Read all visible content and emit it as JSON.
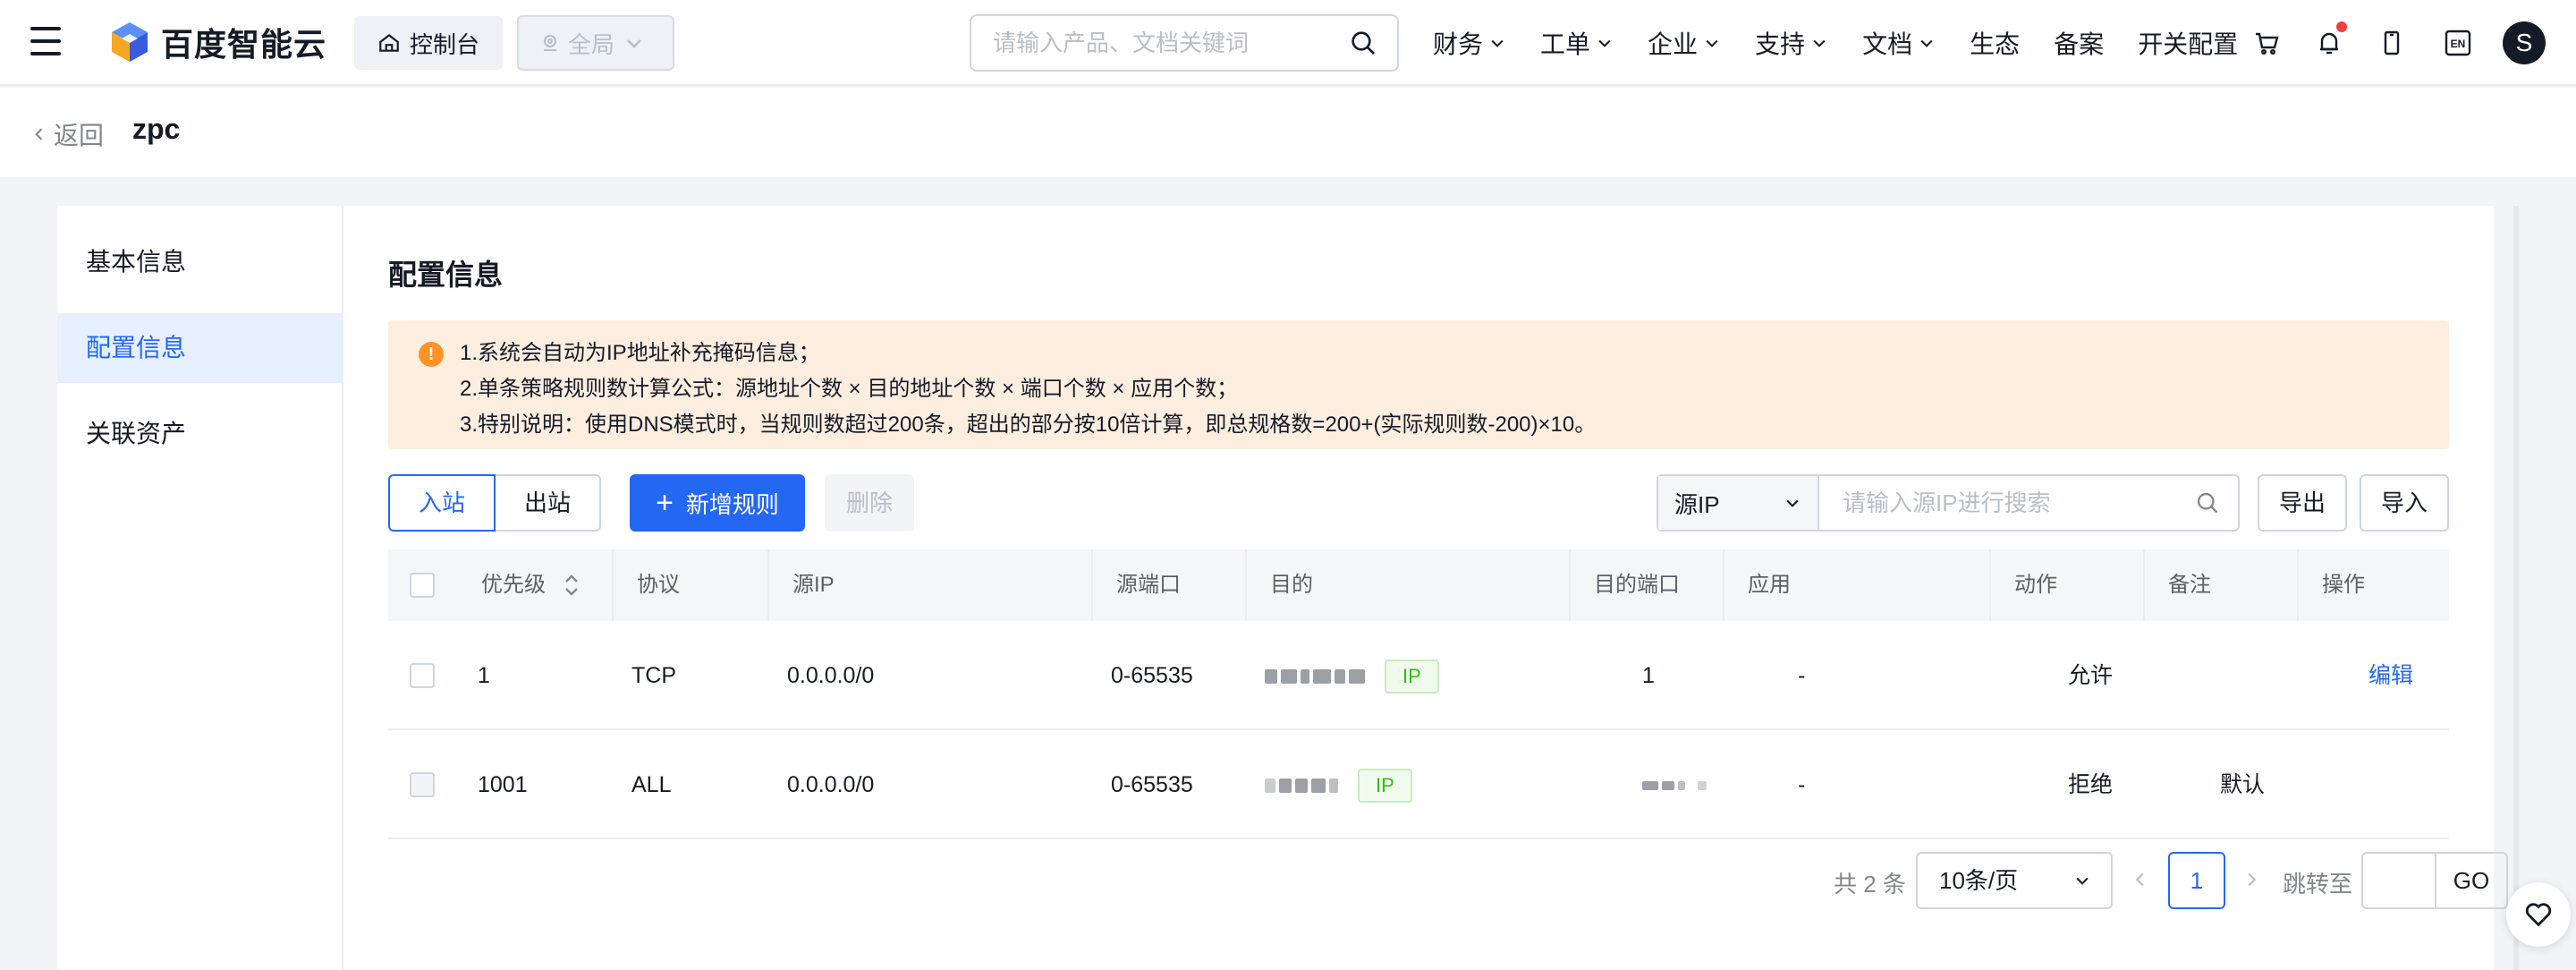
{
  "header": {
    "logo_text": "百度智能云",
    "console_label": "控制台",
    "region_label": "全局",
    "search_placeholder": "请输入产品、文档关键词",
    "nav": [
      "财务",
      "工单",
      "企业",
      "支持",
      "文档",
      "生态",
      "备案",
      "开关配置"
    ],
    "lang_label": "EN",
    "avatar_letter": "S"
  },
  "subheader": {
    "back_label": "返回",
    "title": "zpc"
  },
  "sidebar": {
    "items": [
      {
        "label": "基本信息",
        "active": false
      },
      {
        "label": "配置信息",
        "active": true
      },
      {
        "label": "关联资产",
        "active": false
      }
    ]
  },
  "main": {
    "section_title": "配置信息",
    "notice_lines": [
      "1.系统会自动为IP地址补充掩码信息；",
      "2.单条策略规则数计算公式：源地址个数 × 目的地址个数 × 端口个数 × 应用个数；",
      "3.特别说明：使用DNS模式时，当规则数超过200条，超出的部分按10倍计算，即总规格数=200+(实际规则数-200)×10。"
    ],
    "direction_tabs": [
      "入站",
      "出站"
    ],
    "add_rule_label": "新增规则",
    "delete_label": "删除",
    "filter_select": "源IP",
    "filter_placeholder": "请输入源IP进行搜索",
    "export_label": "导出",
    "import_label": "导入"
  },
  "table": {
    "columns": [
      "优先级",
      "协议",
      "源IP",
      "源端口",
      "目的",
      "目的端口",
      "应用",
      "动作",
      "备注",
      "操作"
    ],
    "rows": [
      {
        "priority": "1",
        "protocol": "TCP",
        "src_ip": "0.0.0.0/0",
        "src_port": "0-65535",
        "dest_tag": "IP",
        "dest_port": "1",
        "app": "-",
        "action": "允许",
        "note": "",
        "op": "编辑"
      },
      {
        "priority": "1001",
        "protocol": "ALL",
        "src_ip": "0.0.0.0/0",
        "src_port": "0-65535",
        "dest_tag": "IP",
        "dest_port": "",
        "app": "-",
        "action": "拒绝",
        "note": "默认",
        "op": ""
      }
    ]
  },
  "pagination": {
    "total_text": "共 2 条",
    "page_size": "10条/页",
    "current_page": "1",
    "jump_label": "跳转至",
    "go_label": "GO"
  },
  "colors": {
    "primary": "#2468f2",
    "warning": "#ff9326",
    "notice_bg": "#fdeee0",
    "tag_green": "#30bf13",
    "bell_dot": "#f33e3e"
  }
}
